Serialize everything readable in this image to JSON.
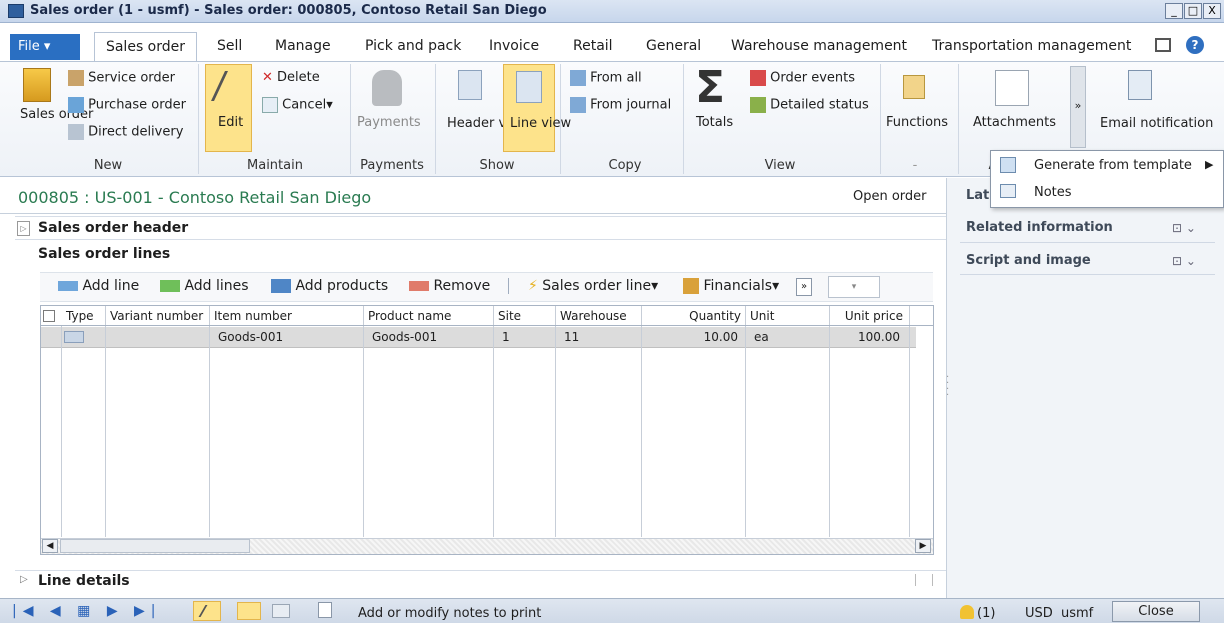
{
  "window": {
    "title": "Sales order (1 - usmf) - Sales order: 000805, Contoso Retail San Diego",
    "min": "_",
    "max": "□",
    "close": "X"
  },
  "tabs": {
    "file": "File",
    "items": [
      "Sales order",
      "Sell",
      "Manage",
      "Pick and pack",
      "Invoice",
      "Retail",
      "General",
      "Warehouse management",
      "Transportation management"
    ]
  },
  "ribbon": {
    "new": {
      "sales_order": "Sales order",
      "service_order": "Service order",
      "purchase_order": "Purchase order",
      "direct_delivery": "Direct delivery",
      "group": "New"
    },
    "maintain": {
      "edit": "Edit",
      "delete": "Delete",
      "cancel": "Cancel",
      "group": "Maintain"
    },
    "payments": {
      "payments": "Payments",
      "group": "Payments"
    },
    "show": {
      "header_view": "Header view",
      "line_view": "Line view",
      "group": "Show"
    },
    "copy": {
      "from_all": "From all",
      "from_journal": "From journal",
      "group": "Copy"
    },
    "view": {
      "totals": "Totals",
      "order_events": "Order events",
      "detailed_status": "Detailed status",
      "group": "View"
    },
    "functions": {
      "functions": "Functions",
      "group": "-"
    },
    "attach": {
      "attachments": "Attachments",
      "email": "Email notification",
      "group": "A",
      "more": "»"
    }
  },
  "popup": {
    "generate": "Generate from template",
    "notes": "Notes"
  },
  "order": {
    "title": "000805 : US-001 - Contoso Retail San Diego",
    "status": "Open order"
  },
  "factbox": {
    "latest": "Lat",
    "related": "Related information",
    "script": "Script and image"
  },
  "sections": {
    "header": "Sales order header",
    "lines": "Sales order lines",
    "details": "Line details"
  },
  "linetools": {
    "add_line": "Add line",
    "add_lines": "Add lines",
    "add_products": "Add products",
    "remove": "Remove",
    "sales_order_line": "Sales order line",
    "financials": "Financials",
    "more": "»"
  },
  "grid": {
    "columns": [
      "Type",
      "Variant number",
      "Item number",
      "Product name",
      "Site",
      "Warehouse",
      "Quantity",
      "Unit",
      "Unit price"
    ],
    "rows": [
      {
        "type": "",
        "variant": "",
        "item": "Goods-001",
        "product": "Goods-001",
        "site": "1",
        "warehouse": "11",
        "quantity": "10.00",
        "unit": "ea",
        "price": "100.00"
      }
    ]
  },
  "status": {
    "notes_text": "Add or modify notes to print",
    "alerts": "(1)",
    "currency": "USD",
    "company": "usmf",
    "close": "Close"
  }
}
